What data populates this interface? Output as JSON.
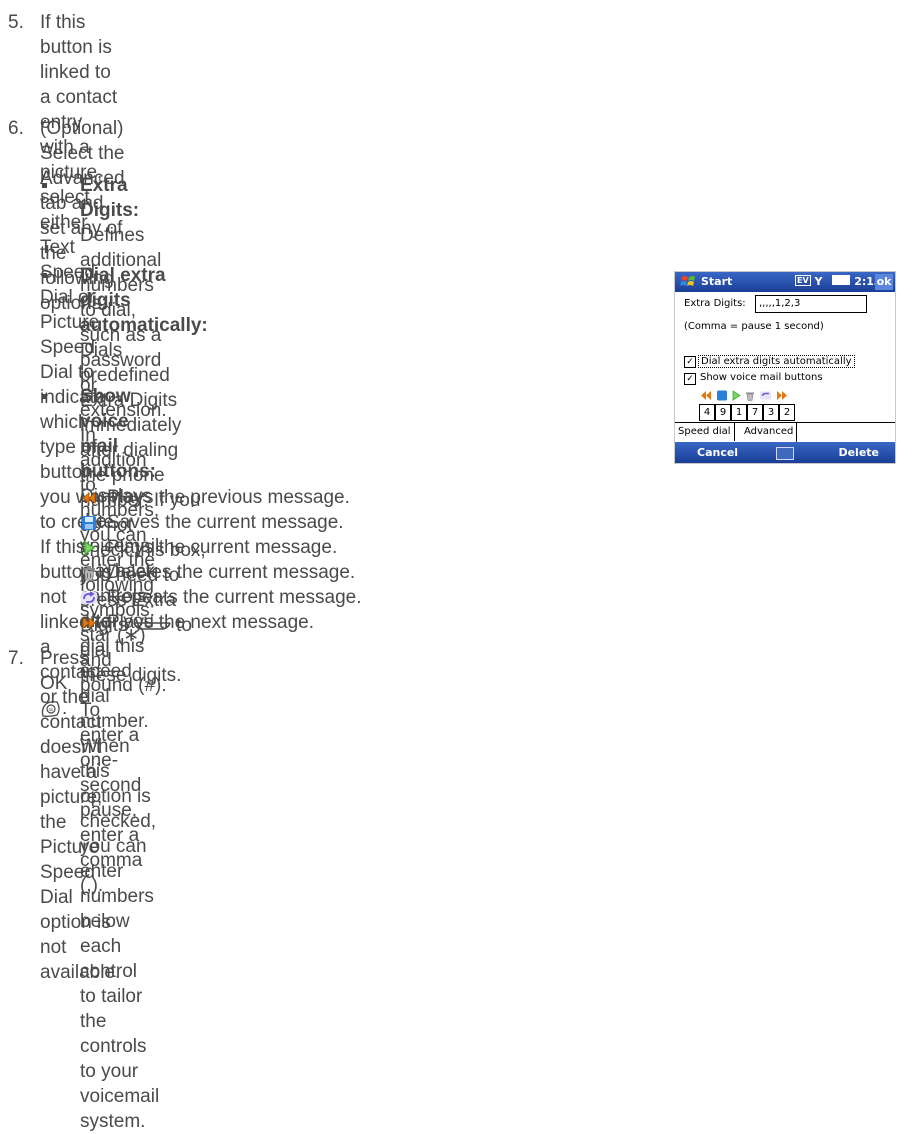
{
  "steps": {
    "s5": {
      "num": "5.",
      "line1": "If this button is linked to a contact entry with a picture, select either Text Speed Dial or Picture",
      "line2": "Speed Dial to indicate which type of button you want to create. If this button is not linked to a",
      "line3": "contact or the contact doesn’t have a picture, the Picture Speed Dial option is not available."
    },
    "s6": {
      "num": "6.",
      "line1": "(Optional) Select the Advanced tab and set any of the following options:"
    },
    "s7": {
      "num": "7.",
      "text": "Press OK"
    }
  },
  "bullets": {
    "extra_digits": {
      "term": "Extra Digits:",
      "line1": " Defines additional numbers to dial, such as a password or extension. In",
      "line2": "addition to numbers, you can enter the following symbols: star (∗) and pound (#). To",
      "line3": "enter a one-second pause, enter a comma (,)."
    },
    "dial_auto": {
      "term": "Dial extra digits automatically:",
      "line1": " Dials predefined Extra Digits",
      "line2": "immediately after dialing the phone number. If you do not",
      "line3a": "check this box, you need to press Extra Digits",
      "line3b": " to dial",
      "line4": "these digits."
    },
    "show_vm": {
      "term": "Show voice mail buttons:",
      "line1": " Displays the voicemail playback",
      "line2": "controls after you dial this speed dial number. When this",
      "line3": "option is checked, you can enter numbers below each control",
      "line4": "to tailor the controls to your voicemail system."
    }
  },
  "vm_controls": [
    {
      "icon": "previous-icon",
      "text": "Plays the previous message."
    },
    {
      "icon": "save-icon",
      "text": "Saves the current message."
    },
    {
      "icon": "play-icon",
      "text": "Plays the current message."
    },
    {
      "icon": "delete-icon",
      "text": "Deletes the current message."
    },
    {
      "icon": "repeat-icon",
      "text": "Repeats the current message."
    },
    {
      "icon": "next-icon",
      "text": "Plays the next message."
    }
  ],
  "device": {
    "title": "Start",
    "status": "2:13",
    "ok": "ok",
    "extra_digits_label": "Extra Digits:",
    "extra_digits_value": ",,,,,1,2,3",
    "pause_note": "(Comma = pause 1 second)",
    "dial_auto_label": "Dial extra digits automatically",
    "show_vm_label": "Show voice mail buttons",
    "digits": [
      "4",
      "9",
      "1",
      "7",
      "3",
      "2"
    ],
    "tabs": [
      "Speed dial",
      "Advanced"
    ],
    "left_soft": "Cancel",
    "right_soft": "Delete"
  },
  "colors": {
    "text": "#4a4a4a",
    "titlebar": "#2450b0",
    "prev_next_icon": "#e07a10",
    "save_icon": "#2c7fd6",
    "play_icon": "#3fae2a",
    "repeat_icon": "#6a5acd"
  }
}
